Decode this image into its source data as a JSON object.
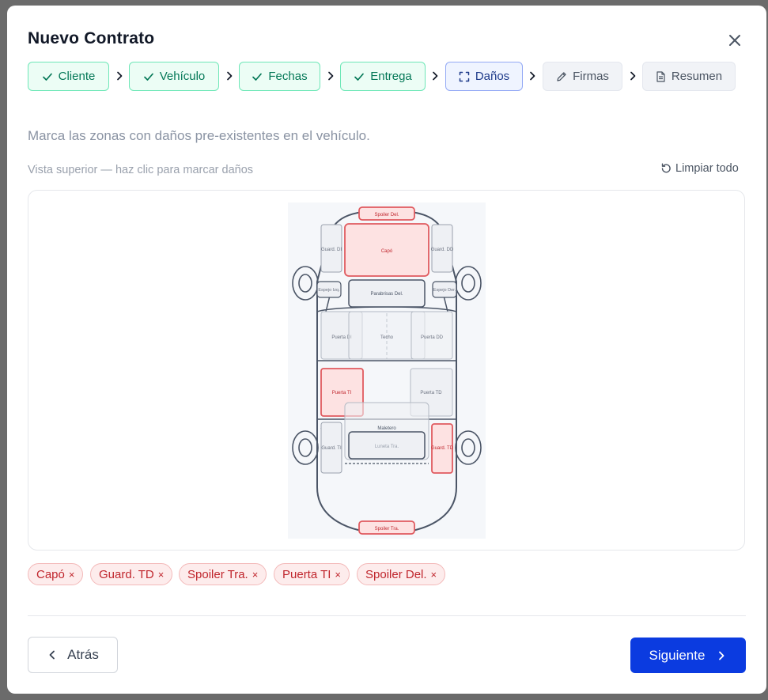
{
  "modal": {
    "title": "Nuevo Contrato",
    "close_icon": "close-icon"
  },
  "steps": [
    {
      "label": "Cliente",
      "status": "done",
      "icon": "check-icon"
    },
    {
      "label": "Vehículo",
      "status": "done",
      "icon": "check-icon"
    },
    {
      "label": "Fechas",
      "status": "done",
      "icon": "check-icon"
    },
    {
      "label": "Entrega",
      "status": "done",
      "icon": "check-icon"
    },
    {
      "label": "Daños",
      "status": "active",
      "icon": "scan-icon"
    },
    {
      "label": "Firmas",
      "status": "pending",
      "icon": "pencil-icon"
    },
    {
      "label": "Resumen",
      "status": "pending",
      "icon": "document-icon"
    }
  ],
  "damage": {
    "intro": "Marca las zonas con daños pre-existentes en el vehículo.",
    "view_label": "Vista superior — haz clic para marcar daños",
    "clear_label": "Limpiar todo",
    "zones": {
      "spoiler_del": "Spoiler Del.",
      "capo": "Capó",
      "guard_di": "Guard. DI",
      "guard_dd": "Guard. DD",
      "espejo_izq": "Espejo Izq.",
      "espejo_der": "Espejo Der.",
      "parabrisas_del": "Parabrisas Del.",
      "puerta_di": "Puerta DI",
      "techo": "Techo",
      "puerta_dd": "Puerta DD",
      "puerta_ti": "Puerta TI",
      "puerta_td": "Puerta TD",
      "maletero": "Maletero",
      "luneta_tra": "Luneta Tra.",
      "guard_ti": "Guard. TI",
      "guard_td": "Guard. TD",
      "spoiler_tra": "Spoiler Tra."
    },
    "marked": [
      "capo",
      "guard_td",
      "spoiler_tra",
      "puerta_ti",
      "spoiler_del"
    ],
    "selected_tags": [
      {
        "label": "Capó",
        "remove": "×"
      },
      {
        "label": "Guard. TD",
        "remove": "×"
      },
      {
        "label": "Spoiler Tra.",
        "remove": "×"
      },
      {
        "label": "Puerta TI",
        "remove": "×"
      },
      {
        "label": "Spoiler Del.",
        "remove": "×"
      }
    ]
  },
  "footer": {
    "back_label": "Atrás",
    "next_label": "Siguiente"
  },
  "colors": {
    "done": "#047857",
    "active": "#1e3a8a",
    "marked_fill": "#fde2e2",
    "marked_stroke": "#e05a5f",
    "primary": "#0b3be0"
  }
}
